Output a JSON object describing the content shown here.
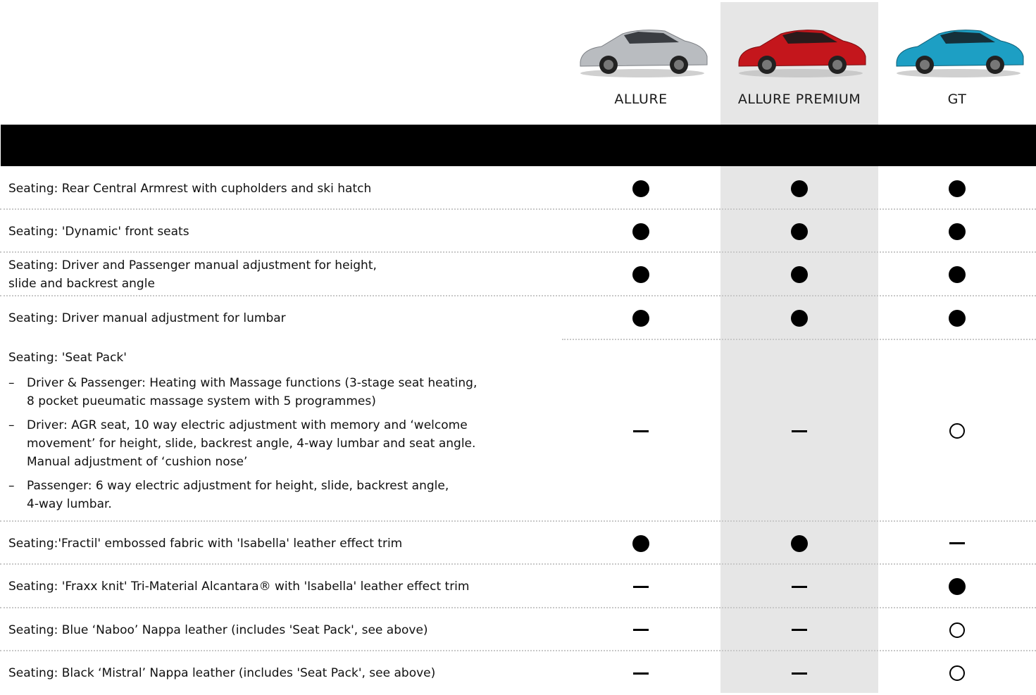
{
  "trims": [
    {
      "name": "ALLURE",
      "car_icon": "car-image-silver",
      "car_color": "#b9bcc0"
    },
    {
      "name": "ALLURE PREMIUM",
      "car_icon": "car-image-red",
      "car_color": "#c4161c"
    },
    {
      "name": "GT",
      "car_icon": "car-image-blue",
      "car_color": "#1d9fc4"
    }
  ],
  "colors": {
    "highlight_column": "#e6e6e6",
    "section_bar": "#000000",
    "divider": "#c8c8c8"
  },
  "legend_marks": {
    "standard": "filled-circle",
    "option": "hollow-circle",
    "not_available": "dash"
  },
  "rows": [
    {
      "lines": [
        "Seating: Rear Central Armrest with cupholders and ski hatch"
      ],
      "values": [
        "standard",
        "standard",
        "standard"
      ]
    },
    {
      "lines": [
        "Seating: 'Dynamic' front seats"
      ],
      "values": [
        "standard",
        "standard",
        "standard"
      ]
    },
    {
      "lines": [
        "Seating: Driver and Passenger manual adjustment for height,",
        "slide and backrest angle"
      ],
      "values": [
        "standard",
        "standard",
        "standard"
      ]
    },
    {
      "lines": [
        "Seating: Driver manual adjustment for lumbar"
      ],
      "values": [
        "standard",
        "standard",
        "standard"
      ]
    },
    {
      "lines": [
        "Seating: 'Seat Pack'"
      ],
      "subitems": [
        {
          "dash": "–",
          "text": "Driver & Passenger: Heating with Massage functions (3-stage seat heating,\n8 pocket pueumatic massage system with 5 programmes)"
        },
        {
          "dash": "–",
          "text": "Driver: AGR seat, 10 way electric adjustment with memory and ‘welcome\nmovement’ for height, slide, backrest angle, 4-way lumbar and seat angle.\nManual adjustment of ‘cushion nose’"
        },
        {
          "dash": "–",
          "text": "Passenger: 6 way electric adjustment for height, slide, backrest angle,\n4-way lumbar."
        }
      ],
      "values": [
        "not_available",
        "not_available",
        "option"
      ]
    },
    {
      "lines": [
        "Seating:'Fractil' embossed fabric with 'Isabella' leather effect trim"
      ],
      "values": [
        "standard",
        "standard",
        "not_available"
      ]
    },
    {
      "lines": [
        "Seating: 'Fraxx knit' Tri-Material Alcantara® with 'Isabella' leather effect trim"
      ],
      "values": [
        "not_available",
        "not_available",
        "standard"
      ]
    },
    {
      "lines": [
        "Seating: Blue ‘Naboo’ Nappa leather (includes 'Seat Pack', see above)"
      ],
      "values": [
        "not_available",
        "not_available",
        "option"
      ]
    },
    {
      "lines": [
        "Seating: Black ‘Mistral’ Nappa leather (includes 'Seat Pack', see above)"
      ],
      "values": [
        "not_available",
        "not_available",
        "option"
      ]
    }
  ]
}
